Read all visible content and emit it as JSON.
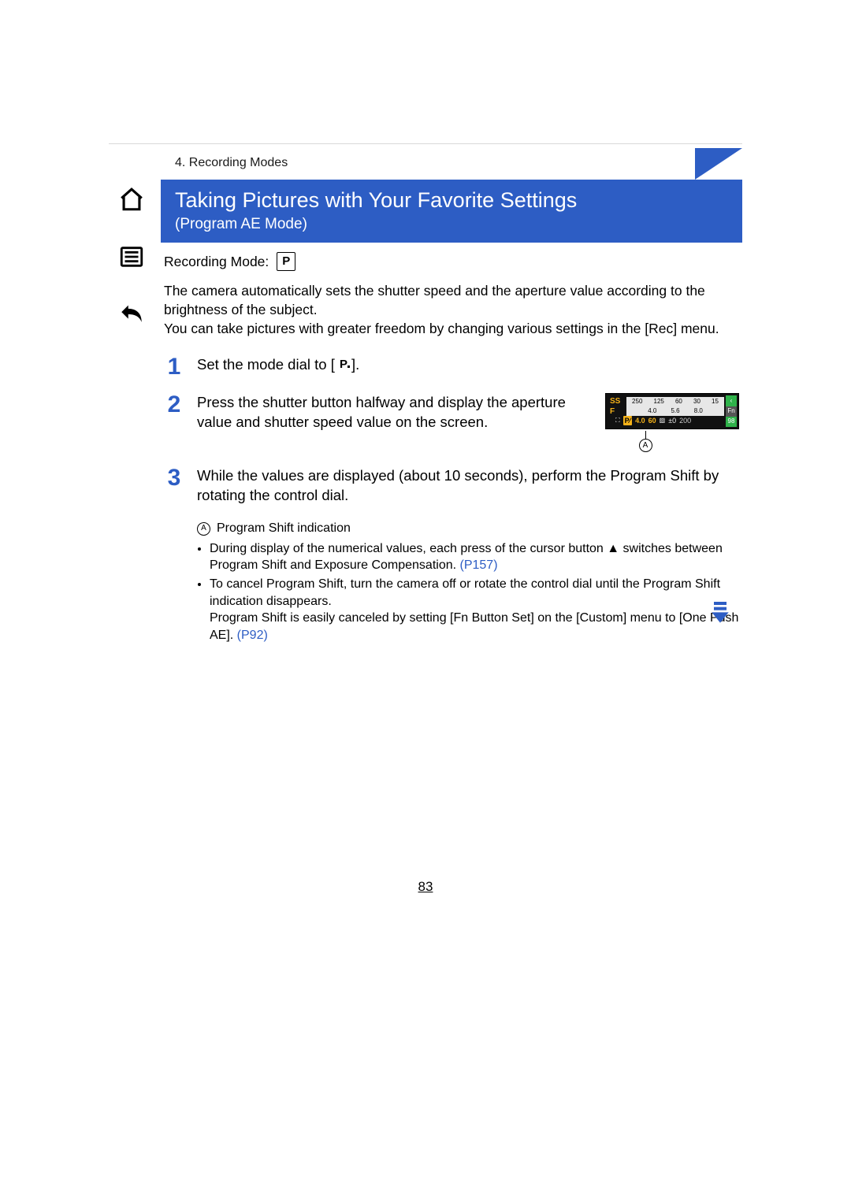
{
  "section_crumb": "4. Recording Modes",
  "title": "Taking Pictures with Your Favorite Settings",
  "subtitle": "(Program AE Mode)",
  "recording_mode_label": "Recording Mode:",
  "mode_letter": "P",
  "intro_1": "The camera automatically sets the shutter speed and the aperture value according to the brightness of the subject.",
  "intro_2": "You can take pictures with greater freedom by changing various settings in the [Rec] menu.",
  "steps": {
    "s1_pre": "Set the mode dial to [",
    "s1_post": "].",
    "s2": "Press the shutter button halfway and display the aperture value and shutter speed value on the screen.",
    "s3": "While the values are displayed (about 10 seconds), perform the Program Shift by rotating the control dial."
  },
  "lcd": {
    "top_row": [
      "250",
      "125",
      "60",
      "30",
      "15"
    ],
    "bot_row": [
      "4.0",
      "5.6",
      "8.0"
    ],
    "ps_badge": "P⁄",
    "aperture": "4.0",
    "shutter": "60",
    "ev_label": "±0",
    "remaining": "200",
    "side_badge_1": "‹",
    "side_badge_2": "Fn",
    "side_badge_3": "98",
    "pointer_label": "A"
  },
  "notes": {
    "label_letter": "A",
    "label_text": "Program Shift indication",
    "bullet1_a": "During display of the numerical values, each press of the cursor button ",
    "bullet1_b": " switches between Program Shift and Exposure Compensation.",
    "link1": " (P157)",
    "bullet2_a": "To cancel Program Shift, turn the camera off or rotate the control dial until the Program Shift indication disappears.",
    "bullet2_b": "Program Shift is easily canceled by setting [Fn Button Set] on the [Custom] menu to [One Push AE].",
    "link2": " (P92)"
  },
  "page_number": "83"
}
